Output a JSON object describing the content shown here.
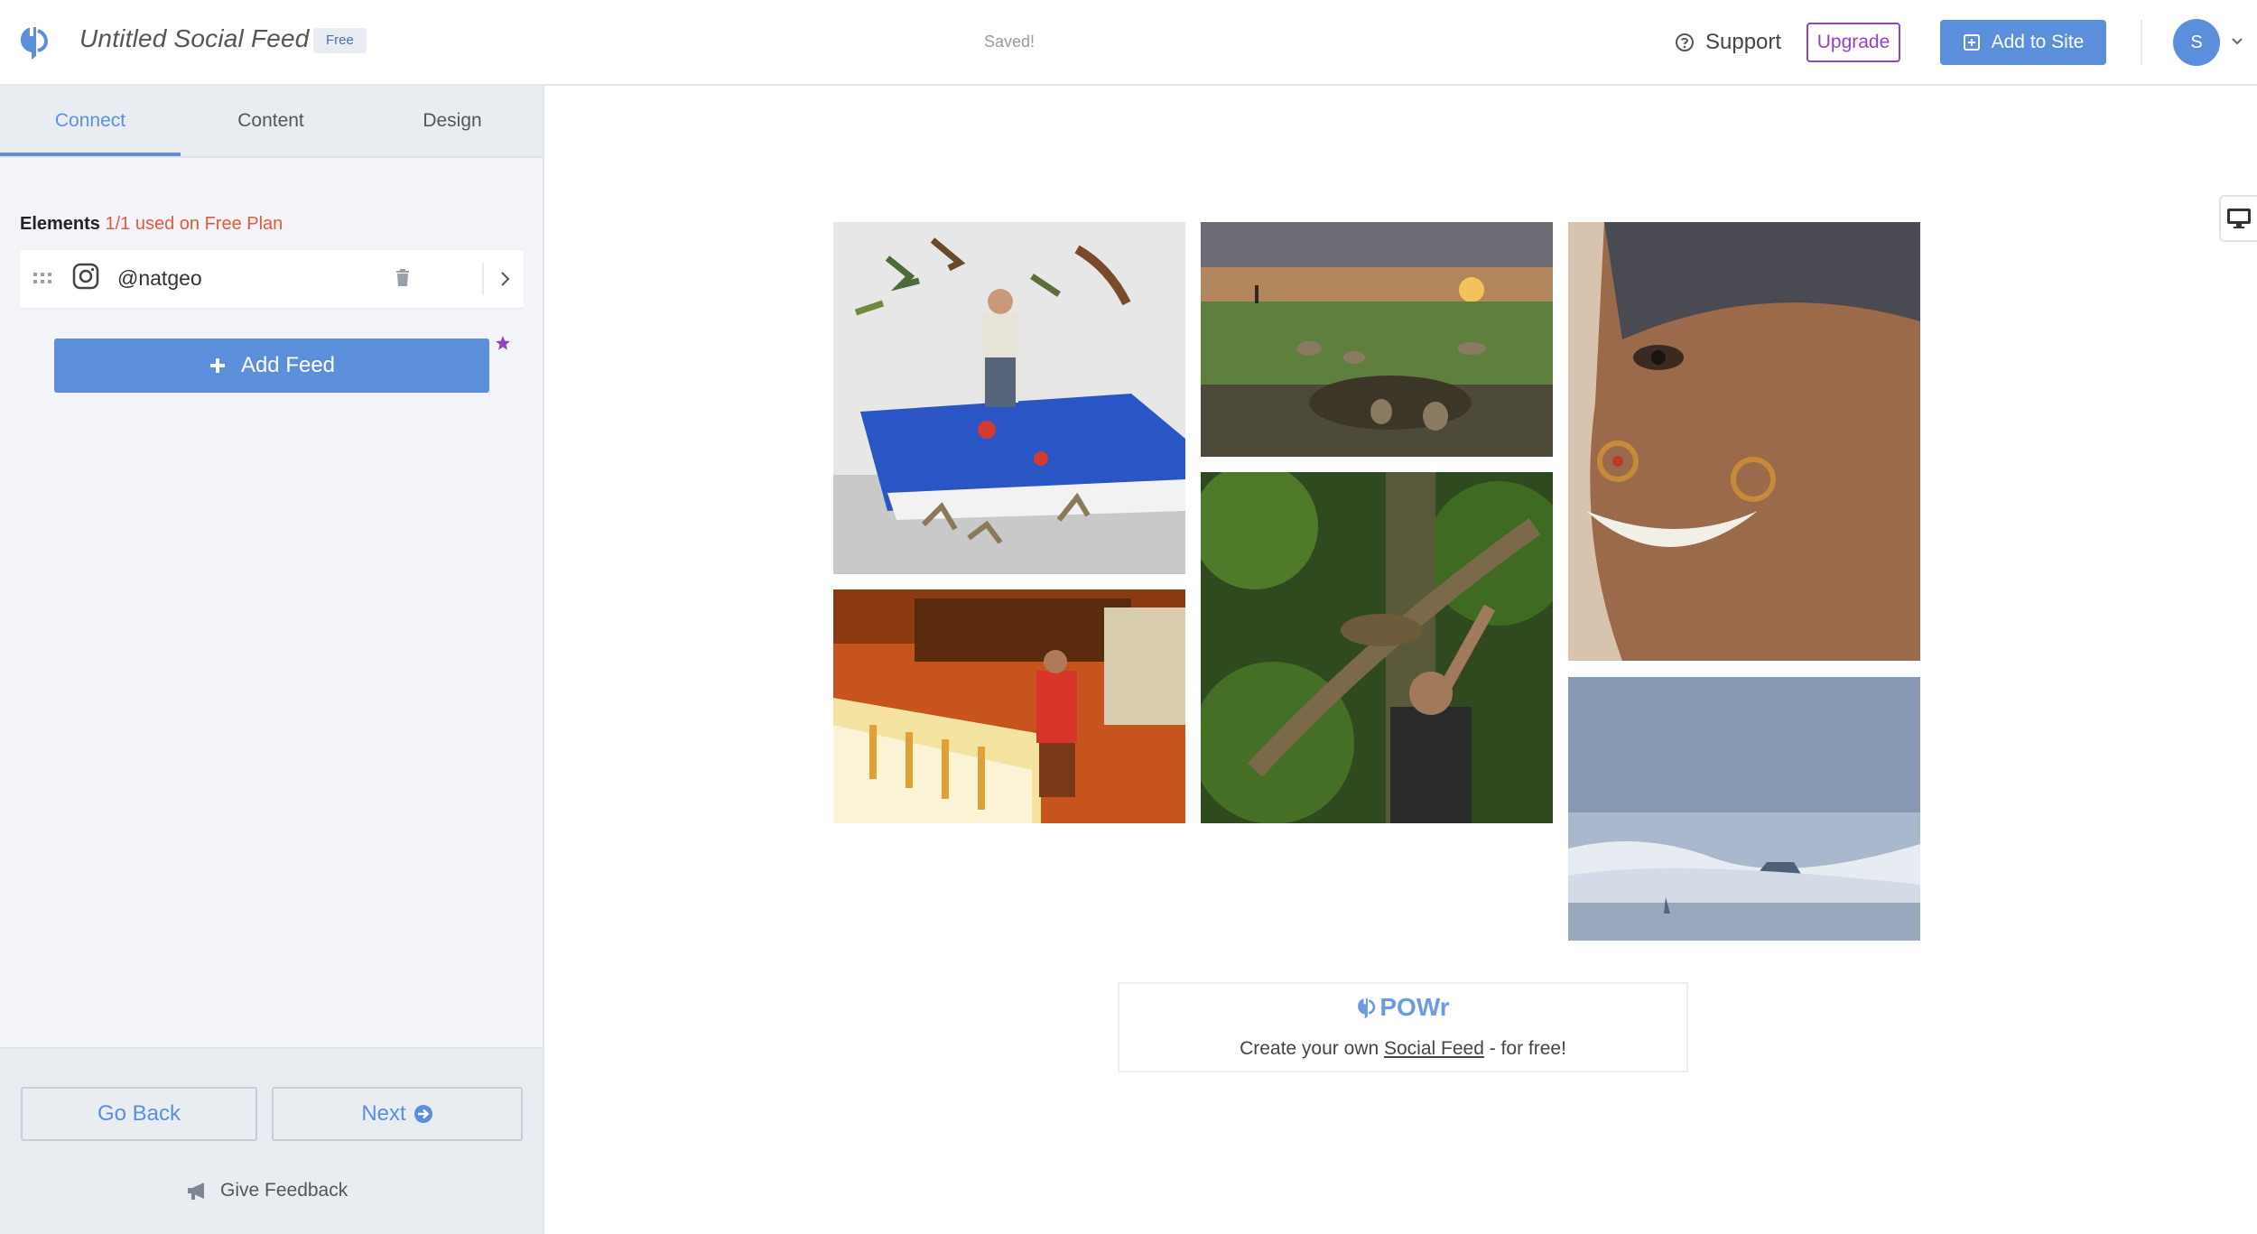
{
  "header": {
    "app_title": "Untitled Social Feed",
    "plan_badge": "Free",
    "save_status": "Saved!",
    "support_label": "Support",
    "upgrade_label": "Upgrade",
    "add_to_site_label": "Add to Site",
    "avatar_initial": "S",
    "accent_color": "#5b8fdc",
    "upgrade_color": "#8e44c4"
  },
  "sidebar": {
    "tabs": [
      {
        "label": "Connect",
        "active": true
      },
      {
        "label": "Content",
        "active": false
      },
      {
        "label": "Design",
        "active": false
      }
    ],
    "elements": {
      "label": "Elements",
      "usage": "1/1 used on Free Plan",
      "usage_color": "#e05a3a"
    },
    "feeds": [
      {
        "source_icon": "instagram-icon",
        "handle": "@natgeo"
      }
    ],
    "add_feed_label": "Add Feed",
    "footer": {
      "go_back_label": "Go Back",
      "next_label": "Next",
      "feedback_label": "Give Feedback"
    }
  },
  "preview": {
    "photos": [
      {
        "subject": "boy standing on bed with toy dragons"
      },
      {
        "subject": "bar interior with man in red shirt"
      },
      {
        "subject": "hyenas on savanna at sunset"
      },
      {
        "subject": "man holding branch with wild cat in rainforest"
      },
      {
        "subject": "smiling woman with nose ring"
      },
      {
        "subject": "icy coastline with fog"
      }
    ],
    "branding": {
      "brand_name": "POWr",
      "tagline_prefix": "Create your own",
      "tagline_link": "Social Feed",
      "tagline_suffix": "- for free!"
    }
  }
}
